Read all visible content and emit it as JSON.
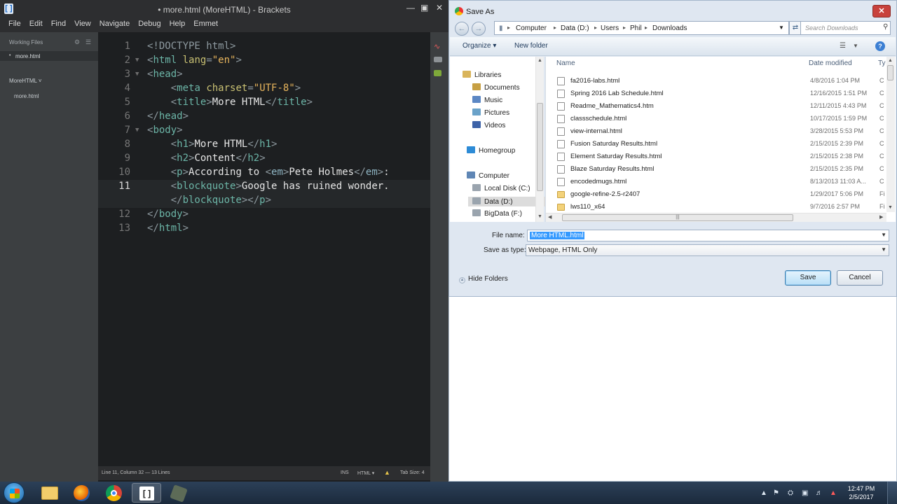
{
  "brackets": {
    "title": "• more.html (MoreHTML) - Brackets",
    "menu": [
      "File",
      "Edit",
      "Find",
      "View",
      "Navigate",
      "Debug",
      "Help",
      "Emmet"
    ],
    "sidebar": {
      "working_files_label": "Working Files",
      "working_file": "more.html",
      "project_label": "MoreHTML ˅",
      "project_file": "more.html"
    },
    "code_lines": [
      {
        "num": "1",
        "html": "<span class=\"tg\">&lt;!DOCTYPE html&gt;</span>"
      },
      {
        "num": "2",
        "html": "<span class=\"tg\">&lt;</span><span class=\"tag\">html</span> <span class=\"at\">lang</span><span class=\"tg\">=</span><span class=\"st\">\"en\"</span><span class=\"tg\">&gt;</span>"
      },
      {
        "num": "3",
        "html": "<span class=\"tg\">&lt;</span><span class=\"tag\">head</span><span class=\"tg\">&gt;</span>"
      },
      {
        "num": "4",
        "html": "    <span class=\"tg\">&lt;</span><span class=\"tag\">meta</span> <span class=\"at\">charset</span><span class=\"tg\">=</span><span class=\"st\">\"UTF-8\"</span><span class=\"tg\">&gt;</span>"
      },
      {
        "num": "5",
        "html": "    <span class=\"tg\">&lt;</span><span class=\"tag\">title</span><span class=\"tg\">&gt;</span>More HTML<span class=\"tg\">&lt;/</span><span class=\"tag\">title</span><span class=\"tg\">&gt;</span>"
      },
      {
        "num": "6",
        "html": "<span class=\"tg\">&lt;/</span><span class=\"tag\">head</span><span class=\"tg\">&gt;</span>"
      },
      {
        "num": "7",
        "html": "<span class=\"tg\">&lt;</span><span class=\"tag\">body</span><span class=\"tg\">&gt;</span>"
      },
      {
        "num": "8",
        "html": "    <span class=\"tg\">&lt;</span><span class=\"tag\">h1</span><span class=\"tg\">&gt;</span>More HTML<span class=\"tg\">&lt;/</span><span class=\"tag\">h1</span><span class=\"tg\">&gt;</span>"
      },
      {
        "num": "9",
        "html": "    <span class=\"tg\">&lt;</span><span class=\"tag\">h2</span><span class=\"tg\">&gt;</span>Content<span class=\"tg\">&lt;/</span><span class=\"tag\">h2</span><span class=\"tg\">&gt;</span>"
      },
      {
        "num": "10",
        "html": "    <span class=\"tg\">&lt;</span><span class=\"tag\">p</span><span class=\"tg\">&gt;</span>According to <span class=\"tg\">&lt;</span><span class=\"em\">em</span><span class=\"tg\">&gt;</span>Pete Holmes<span class=\"tg\">&lt;/</span><span class=\"em\">em</span><span class=\"tg\">&gt;</span>:"
      },
      {
        "num": "11",
        "html": "    <span class=\"tg\">&lt;</span><span class=\"tag\">blockquote</span><span class=\"tg\">&gt;</span>Google has ruined wonder."
      },
      {
        "num": "",
        "html": "    <span class=\"tg\">&lt;/</span><span class=\"tag\">blockquote</span><span class=\"tg\">&gt;&lt;/</span><span class=\"tag\">p</span><span class=\"tg\">&gt;</span>"
      },
      {
        "num": "12",
        "html": "<span class=\"tg\">&lt;/</span><span class=\"tag\">body</span><span class=\"tg\">&gt;</span>"
      },
      {
        "num": "13",
        "html": "<span class=\"tg\">&lt;/</span><span class=\"tag\">html</span><span class=\"tg\">&gt;</span>"
      }
    ],
    "status": {
      "position": "Line 11, Column 32 — 13 Lines",
      "mode": "INS",
      "language": "HTML ▾",
      "tab_size": "Tab Size: 4"
    }
  },
  "dialog": {
    "title": "Save As",
    "breadcrumb": [
      "Computer",
      "Data (D:)",
      "Users",
      "Phil",
      "Downloads"
    ],
    "search_placeholder": "Search Downloads",
    "organize_label": "Organize ▾",
    "new_folder_label": "New folder",
    "nav_pane": [
      {
        "label": "Libraries",
        "icon": "libraries-icon",
        "color": "#d9b45a"
      },
      {
        "label": "Documents",
        "icon": "documents-icon",
        "color": "#c7a043"
      },
      {
        "label": "Music",
        "icon": "music-icon",
        "color": "#5b87c4"
      },
      {
        "label": "Pictures",
        "icon": "pictures-icon",
        "color": "#6aa2c9"
      },
      {
        "label": "Videos",
        "icon": "videos-icon",
        "color": "#3d63a8"
      },
      {
        "label": "Homegroup",
        "icon": "homegroup-icon",
        "color": "#2d8bd6"
      },
      {
        "label": "Computer",
        "icon": "computer-icon",
        "color": "#5f86b5"
      },
      {
        "label": "Local Disk (C:)",
        "icon": "disk-icon",
        "color": "#9aa4ae"
      },
      {
        "label": "Data (D:)",
        "icon": "disk-icon",
        "color": "#9aa4ae"
      },
      {
        "label": "BigData (F:)",
        "icon": "disk-icon",
        "color": "#9aa4ae"
      }
    ],
    "columns": {
      "name": "Name",
      "date": "Date modified",
      "type": "Ty"
    },
    "files": [
      {
        "name": "fa2016-labs.html",
        "date": "4/8/2016 1:04 PM",
        "type": "C",
        "folder": false
      },
      {
        "name": "Spring 2016 Lab Schedule.html",
        "date": "12/16/2015 1:51 PM",
        "type": "C",
        "folder": false
      },
      {
        "name": "Readme_Mathematics4.htm",
        "date": "12/11/2015 4:43 PM",
        "type": "C",
        "folder": false
      },
      {
        "name": "classschedule.html",
        "date": "10/17/2015 1:59 PM",
        "type": "C",
        "folder": false
      },
      {
        "name": "view-internal.html",
        "date": "3/28/2015 5:53 PM",
        "type": "C",
        "folder": false
      },
      {
        "name": "Fusion Saturday Results.html",
        "date": "2/15/2015 2:39 PM",
        "type": "C",
        "folder": false
      },
      {
        "name": "Element Saturday Results.html",
        "date": "2/15/2015 2:38 PM",
        "type": "C",
        "folder": false
      },
      {
        "name": "Blaze Saturday Results.html",
        "date": "2/15/2015 2:35 PM",
        "type": "C",
        "folder": false
      },
      {
        "name": "encodedmugs.html",
        "date": "8/13/2013 11:03 A...",
        "type": "C",
        "folder": false
      },
      {
        "name": "google-refine-2.5-r2407",
        "date": "1/29/2017 5:06 PM",
        "type": "Fi",
        "folder": true
      },
      {
        "name": "lws110_x64",
        "date": "9/7/2016 2:57 PM",
        "type": "Fi",
        "folder": true
      }
    ],
    "file_name_label": "File name:",
    "file_name_value": "More HTML.html",
    "save_type_label": "Save as type:",
    "save_type_value": "Webpage, HTML Only",
    "hide_folders_label": "Hide Folders",
    "save_label": "Save",
    "cancel_label": "Cancel"
  },
  "taskbar": {
    "apps": [
      "windows-explorer-icon",
      "firefox-icon",
      "chrome-icon",
      "brackets-icon",
      "app-icon"
    ],
    "time": "12:47 PM",
    "date": "2/5/2017"
  }
}
